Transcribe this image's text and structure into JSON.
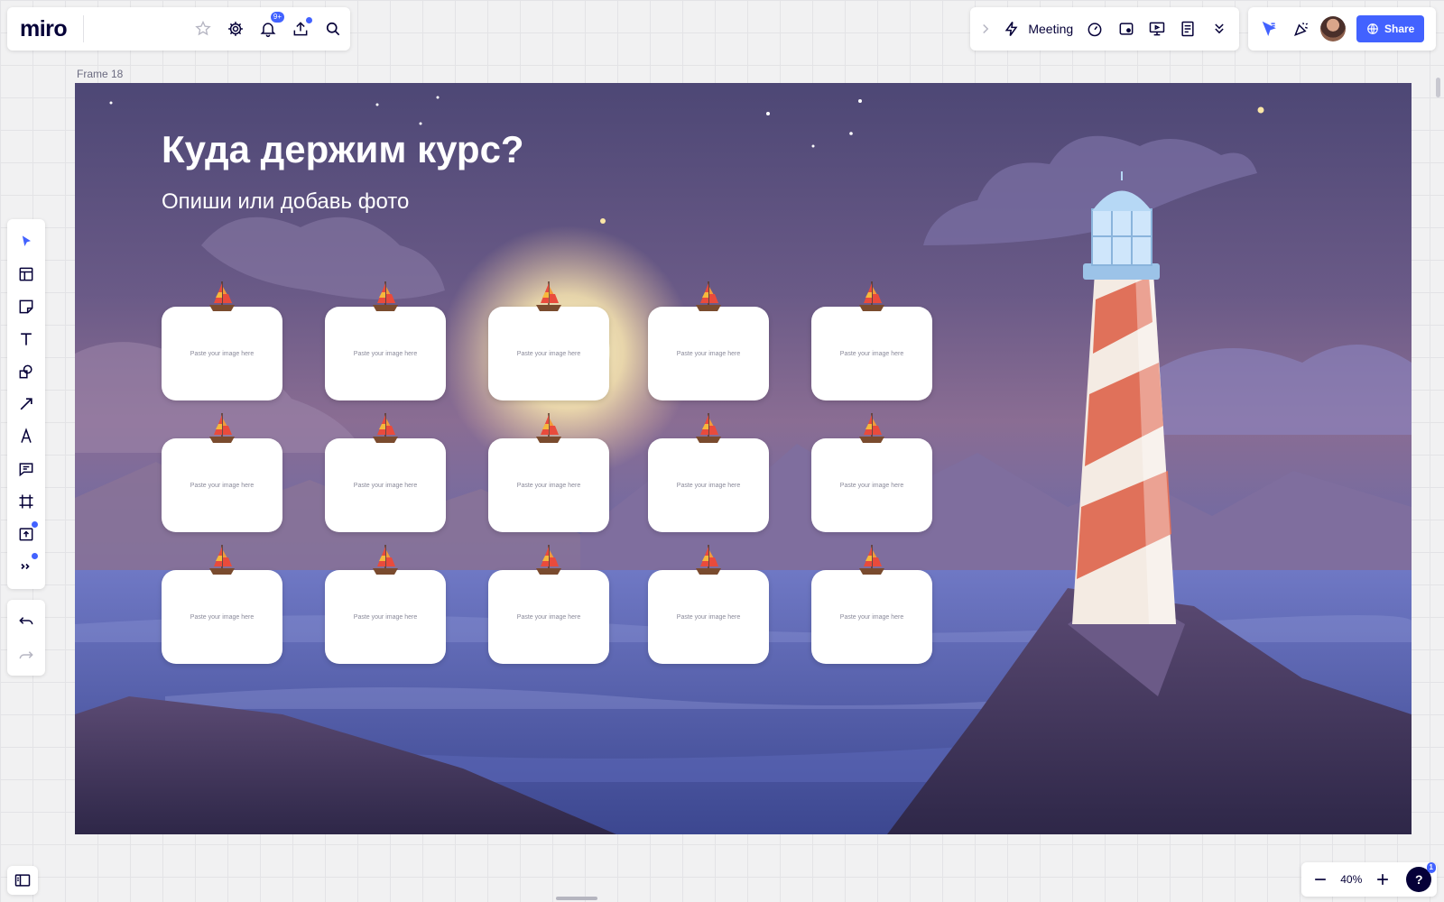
{
  "app": {
    "logo": "miro"
  },
  "topbar": {
    "notification_badge": "9+",
    "meeting_label": "Meeting",
    "share_label": "Share"
  },
  "frame": {
    "label": "Frame 18",
    "title": "Куда держим курс?",
    "subtitle": "Опиши или добавь фото"
  },
  "cards": [
    {
      "text": "Paste your image here"
    },
    {
      "text": "Paste your image here"
    },
    {
      "text": "Paste your image here"
    },
    {
      "text": "Paste your image here"
    },
    {
      "text": "Paste your image here"
    },
    {
      "text": "Paste your image here"
    },
    {
      "text": "Paste your image here"
    },
    {
      "text": "Paste your image here"
    },
    {
      "text": "Paste your image here"
    },
    {
      "text": "Paste your image here"
    },
    {
      "text": "Paste your image here"
    },
    {
      "text": "Paste your image here"
    },
    {
      "text": "Paste your image here"
    },
    {
      "text": "Paste your image here"
    },
    {
      "text": "Paste your image here"
    }
  ],
  "zoom": {
    "level": "40%",
    "help_badge": "1"
  },
  "icons": {
    "left_toolbar": [
      "select-icon",
      "templates-icon",
      "sticky-note-icon",
      "text-icon",
      "shapes-icon",
      "connection-line-icon",
      "pen-icon",
      "comment-icon",
      "frame-icon",
      "upload-icon",
      "more-tools-icon"
    ],
    "top": [
      "star-icon",
      "settings-icon",
      "bell-icon",
      "export-icon",
      "search-icon",
      "lightning-icon",
      "timer-icon",
      "card-icon",
      "present-icon",
      "notes-icon",
      "expand-icon",
      "cursor-icon",
      "celebrate-icon",
      "globe-icon"
    ]
  },
  "colors": {
    "accent": "#4262ff",
    "brand_text": "#050038"
  }
}
